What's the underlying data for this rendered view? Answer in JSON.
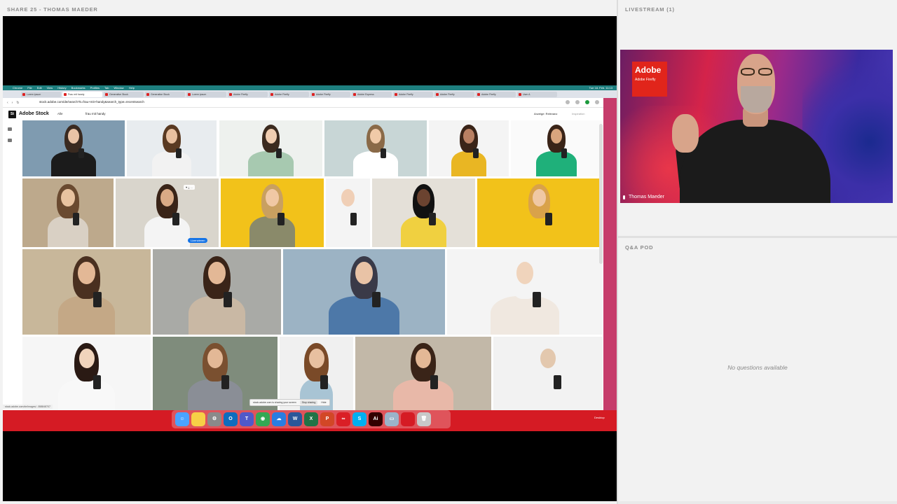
{
  "share_pod": {
    "title": "SHARE 25  - THOMAS MAEDER",
    "menubar": [
      "Chrome",
      "File",
      "Edit",
      "View",
      "History",
      "Bookmarks",
      "Profiles",
      "Tab",
      "Window",
      "Help"
    ],
    "menubar_right": "Tue 18. Feb. 11:13",
    "tabs": [
      "Lorem ipsum",
      "Frau mit handy",
      "Generative Stock",
      "Generative Stock",
      "Lorem ipsum",
      "Adobe Firefly",
      "Adobe Firefly",
      "Adobe Firefly",
      "Adobe Express",
      "Adobe Firefly",
      "Adobe Firefly",
      "Adobe Firefly",
      "User A"
    ],
    "url": "stock.adobe.com/de/search?k=frau+mit+handy&search_type=recentsearch",
    "stock": {
      "logo": "St",
      "brand": "Adobe Stock",
      "filter": "Alle",
      "search_value": "frau mit handy",
      "sort": "Anzeige: Relevanz",
      "inspire": "Inspiration"
    },
    "license_button": "Lizenzieren",
    "hover_icons": "♥ ⤓ ⋯",
    "statusbar": "stock.adobe.com/de/images/...558848707",
    "share_banner": {
      "text": "stock.adobe.com is sharing your screen",
      "stop": "Stop sharing",
      "hide": "Hide"
    },
    "desktop_label": "Desktop",
    "dock": [
      {
        "name": "finder-icon",
        "color": "#4aa3ff",
        "glyph": "☺"
      },
      {
        "name": "notes-icon",
        "color": "#f7d046",
        "glyph": ""
      },
      {
        "name": "settings-icon",
        "color": "#8a8a8a",
        "glyph": "⚙"
      },
      {
        "name": "outlook-icon",
        "color": "#0f6cbd",
        "glyph": "O"
      },
      {
        "name": "teams-icon",
        "color": "#5059c9",
        "glyph": "T"
      },
      {
        "name": "chrome-icon",
        "color": "#34a853",
        "glyph": "◉"
      },
      {
        "name": "onedrive-icon",
        "color": "#2a7de1",
        "glyph": "☁"
      },
      {
        "name": "word-icon",
        "color": "#2b579a",
        "glyph": "W"
      },
      {
        "name": "excel-icon",
        "color": "#217346",
        "glyph": "X"
      },
      {
        "name": "powerpoint-icon",
        "color": "#d24726",
        "glyph": "P"
      },
      {
        "name": "creative-cloud-icon",
        "color": "#da1f26",
        "glyph": "∞"
      },
      {
        "name": "skype-icon",
        "color": "#00aff0",
        "glyph": "S"
      },
      {
        "name": "illustrator-icon",
        "color": "#330000",
        "glyph": "Ai"
      },
      {
        "name": "desktop-folder-icon",
        "color": "#9bb3c9",
        "glyph": "▭"
      },
      {
        "name": "red-folder-icon",
        "color": "#d51b24",
        "glyph": ""
      },
      {
        "name": "trash-icon",
        "color": "#c8c8c8",
        "glyph": "🗑"
      }
    ]
  },
  "livestream": {
    "title": "LIVESTREAM (1)",
    "badge_big": "Adobe",
    "badge_small": "Adobe Firefly",
    "speaker": "Thomas Maeder"
  },
  "qa": {
    "title": "Q&A POD",
    "empty_text": "No questions available"
  },
  "colors": {
    "mac_desktop": "#d51b24",
    "adobe_red": "#e1251b",
    "license_blue": "#1473e6"
  }
}
